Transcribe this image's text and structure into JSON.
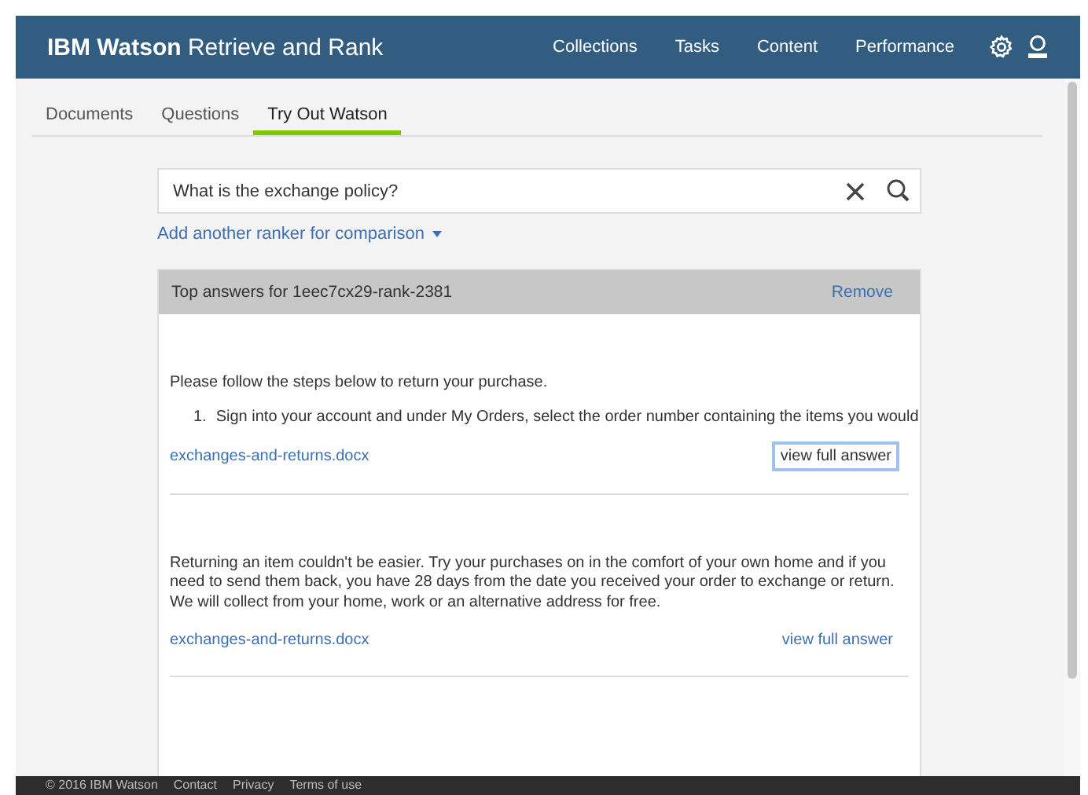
{
  "header": {
    "brand_bold": "IBM Watson",
    "brand_rest": "Retrieve and Rank",
    "nav": [
      "Collections",
      "Tasks",
      "Content",
      "Performance"
    ]
  },
  "tabs": [
    {
      "label": "Documents",
      "selected": false
    },
    {
      "label": "Questions",
      "selected": false
    },
    {
      "label": "Try Out Watson",
      "selected": true
    }
  ],
  "search": {
    "value": "What is the exchange policy?"
  },
  "add_ranker": "Add another ranker for comparison",
  "results_panel": {
    "title": "Top answers for 1eec7cx29-rank-2381",
    "remove": "Remove",
    "answers": [
      {
        "paragraphs": [
          "Please follow the steps below to return your purchase."
        ],
        "list_item": {
          "number": "1.",
          "text": "Sign into your account and under My Orders, select the order number containing the items you would"
        },
        "source": "exchanges-and-returns.docx",
        "view": "view full answer",
        "focused": true
      },
      {
        "paragraphs": [
          "Returning an item couldn't be easier. Try your purchases on in the comfort of your own home and if you need to send them back, you have 28 days from the date you received your order to exchange or return. We will collect from your home, work or an alternative address for free."
        ],
        "source": "exchanges-and-returns.docx",
        "view": "view full answer",
        "focused": false
      }
    ]
  },
  "footer": [
    "© 2016 IBM Watson",
    "Contact",
    "Privacy",
    "Terms of use"
  ]
}
